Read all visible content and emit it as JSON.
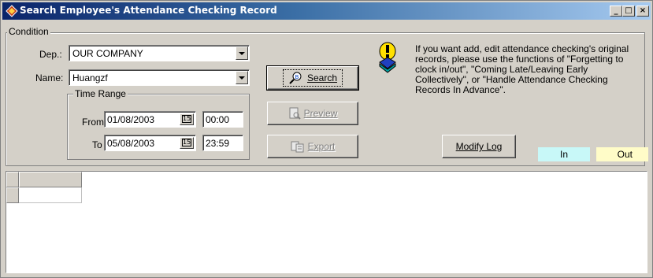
{
  "window": {
    "title": "Search Employee's Attendance Checking Record",
    "controls": {
      "minimize": "_",
      "maximize": "□",
      "close": "×"
    }
  },
  "condition": {
    "group_title": "Condition",
    "department": {
      "label": "Dep.:",
      "value": "OUR COMPANY"
    },
    "name": {
      "label": "Name:",
      "value": "Huangzf"
    },
    "time_range": {
      "group_title": "Time Range",
      "from": {
        "label": "From",
        "date": "01/08/2003",
        "time": "00:00"
      },
      "to": {
        "label": "To",
        "date": "05/08/2003",
        "time": "23:59"
      },
      "calendar_icon_text": "15"
    }
  },
  "buttons": {
    "search": {
      "label": "Search",
      "accel": "S"
    },
    "preview": {
      "label": "Preview",
      "accel": "P"
    },
    "export": {
      "label": "Export",
      "accel": "E"
    },
    "modify_log": {
      "label": "Modify Log",
      "accel": "M"
    }
  },
  "info": {
    "icon": "info-lightbulb-icon",
    "text": "If you want add, edit attendance checking's original records, please use the functions of \"Forgetting to clock in/out\", \"Coming Late/Leaving Early Collectively\", or \"Handle Attendance Checking Records In Advance\"."
  },
  "legend": {
    "in": {
      "label": "In",
      "color": "#c8f8f8"
    },
    "out": {
      "label": "Out",
      "color": "#fffcc8"
    }
  },
  "colors": {
    "title_bar_start": "#0a246a",
    "title_bar_end": "#a6caf0",
    "face": "#d4d0c8"
  }
}
